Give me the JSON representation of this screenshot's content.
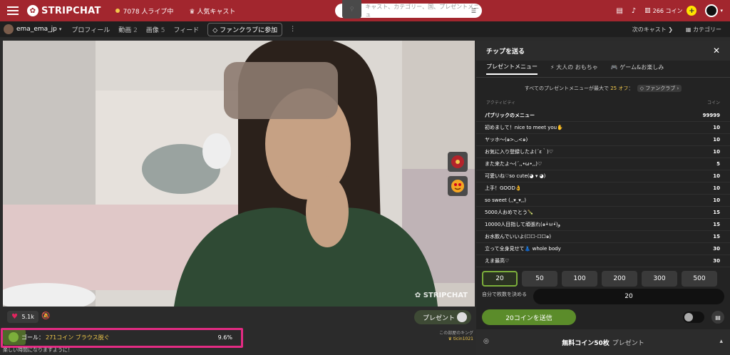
{
  "topbar": {
    "brand": "STRIPCHAT",
    "live_count": "7078 人ライブ中",
    "popular": "人気キャスト",
    "search_placeholder": "キャスト、カテゴリー、国、プレゼントメニュ",
    "coins": "266 コイン",
    "coin_symbol": "+"
  },
  "subbar": {
    "username": "ema_ema_jp",
    "profile": "プロフィール",
    "videos": "動画",
    "videos_count": "2",
    "images": "画像",
    "images_count": "5",
    "feed": "フィード",
    "fanclub_join": "ファンクラブに参加",
    "more": "⋮",
    "next_cast": "次のキャスト",
    "category": "カテゴリー"
  },
  "video": {
    "watermark": "STRIPCHAT",
    "likes": "5.1k",
    "present_label": "プレゼント"
  },
  "goal": {
    "label": "ゴール：",
    "text": "271コイン ブラウス脱ぐ",
    "percent": "9.6%",
    "progress": 0.096
  },
  "king": {
    "label": "この部屋のキング",
    "name": "ticin1021"
  },
  "bottom": {
    "text": "楽しい時間になりますように！"
  },
  "panel": {
    "title": "チップを送る",
    "tabs": [
      "プレゼントメニュー",
      "大人の おもちゃ",
      "ゲーム&お楽しみ"
    ],
    "note_prefix": "すべてのプレゼントメニューが最大で",
    "note_highlight": "25 オフ",
    "note_suffix": "：",
    "note_badge": "ファンクラブ",
    "col_activity": "アクティビティ",
    "col_coins": "コイン",
    "rows": [
      {
        "name": "パブリックのメニュー",
        "coins": "99999"
      },
      {
        "name": "初めまして！nice to meet you✋",
        "coins": "10"
      },
      {
        "name": "ヤッホ〜(๑>◡<๑)",
        "coins": "10"
      },
      {
        "name": "お気に入り登録したよ(´ε｀)♡",
        "coins": "10"
      },
      {
        "name": "また来たよ〜(´,,•ω•,,)♡",
        "coins": "5"
      },
      {
        "name": "可愛いね♡so cute(◕ ▾ ◕)",
        "coins": "10"
      },
      {
        "name": "上手！GOOD👌",
        "coins": "10"
      },
      {
        "name": "so sweet (,,▾_▾,,)",
        "coins": "10"
      },
      {
        "name": "5000人おめでとう🍾",
        "coins": "15"
      },
      {
        "name": "10000人目指して頑張れ(๑•̀ㅂ•́)و",
        "coins": "15"
      },
      {
        "name": "お水飲んでいいよ(☐☐-☐☐๑)",
        "coins": "15"
      },
      {
        "name": "立って全身見せて👗 whole body",
        "coins": "30"
      },
      {
        "name": "えま最高♡",
        "coins": "30"
      }
    ],
    "amounts": [
      "20",
      "50",
      "100",
      "200",
      "300",
      "500"
    ],
    "custom_label": "自分で枚数を決める",
    "custom_value": "20",
    "send_label": "20コインを送信",
    "free_coins": "無料コイン50枚",
    "free_coins_suffix": "プレゼント"
  }
}
